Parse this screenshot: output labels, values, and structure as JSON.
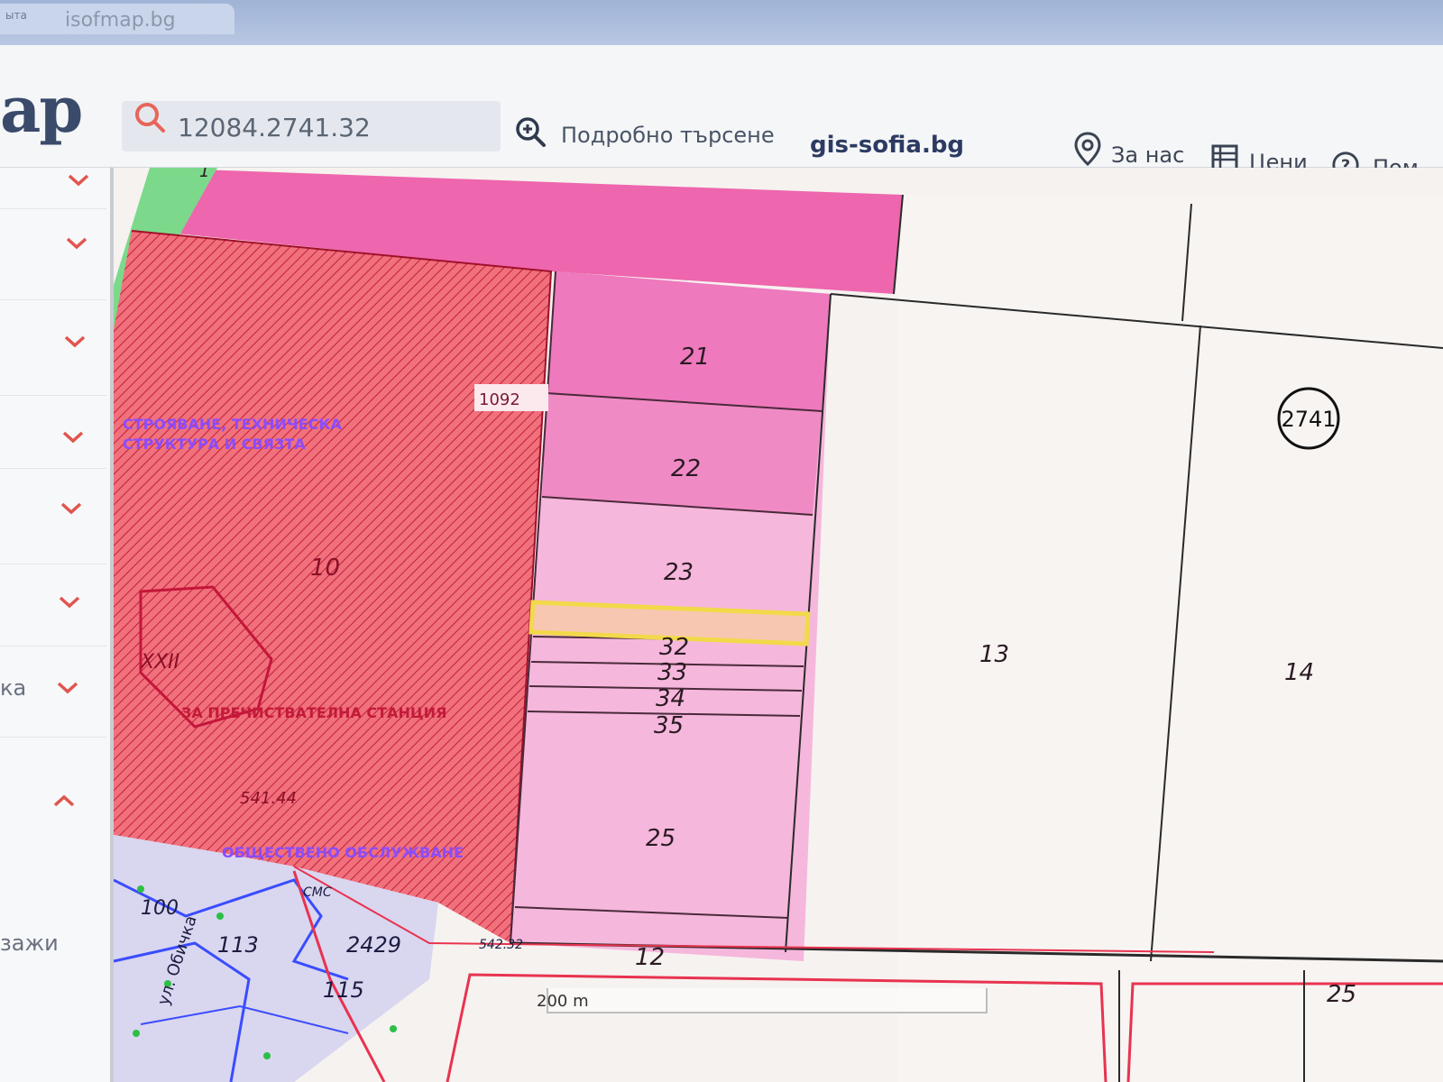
{
  "browser": {
    "tab_pin": "ыта",
    "tab_title": "isofmap.bg"
  },
  "header": {
    "logo": "ap",
    "search_value": "12084.2741.32",
    "advanced_search": "Подробно търсене",
    "gis_link": "gis-sofia.bg",
    "nav": {
      "about": "За нас",
      "prices": "Цени",
      "help": "Пом"
    }
  },
  "sidebar": {
    "labels": {
      "item8": "ка",
      "item10": "зажи"
    }
  },
  "map": {
    "parcel_labels": {
      "p21": "21",
      "p22": "22",
      "p23": "23",
      "p32": "32",
      "p33": "33",
      "p34": "34",
      "p35": "35",
      "p25": "25",
      "p13": "13",
      "p14": "14",
      "p12": "12",
      "p25b": "25",
      "p10": "10",
      "p2_1": "1"
    },
    "block_number": "2741",
    "zone_texts": {
      "z1": "СТРОЯВАНЕ, ТЕХНИЧЕСКА",
      "z2": "СТРУКТУРА И СВЯЗТА",
      "z3": "ЗА ПРЕЧИСТВАТЕЛНА СТАНЦИЯ",
      "z4": "ОБЩЕСТВЕНО ОБСЛУЖВАНЕ",
      "xxii": "XXII",
      "tag": "1092",
      "area": "541.44",
      "street": "ул. Обичка",
      "n113": "113",
      "n115": "115",
      "n2429": "2429",
      "n100": "100",
      "small1": "СМС",
      "small2": "542.32"
    },
    "scale": "200 m"
  },
  "colors": {
    "zone_red": "#ef5f6e",
    "zone_pink": "#ee66ad",
    "parcel_pink": "#f6b7dc",
    "selection": "#f2d94a",
    "zone_text": "#8a4cff",
    "green_strip": "#7cd98b"
  }
}
